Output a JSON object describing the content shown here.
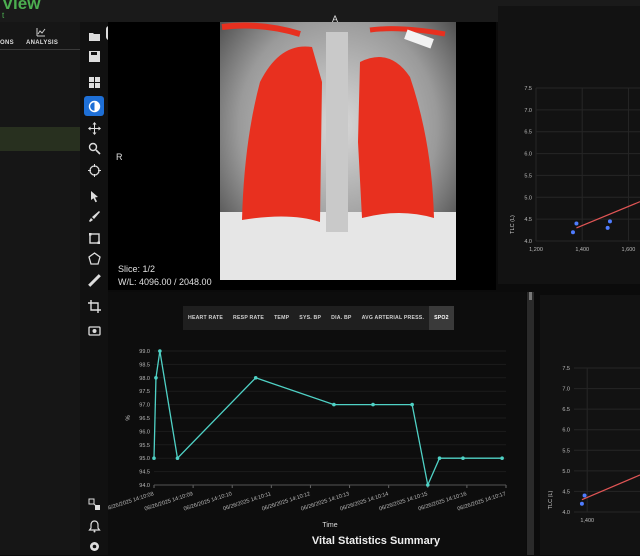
{
  "app": {
    "title": "View",
    "subtitle": "t"
  },
  "left_panel": {
    "tabs": [
      {
        "label": "ONS"
      },
      {
        "label": "ANALYSIS"
      }
    ]
  },
  "toolbar": {
    "tools": [
      "folder-icon",
      "save-icon",
      "layout-icon",
      "contrast-icon",
      "move-icon",
      "zoom-icon",
      "target-icon",
      "pointer-icon",
      "brush-icon",
      "rectangle-icon",
      "polygon-icon",
      "ruler-icon",
      "crop-icon",
      "camera-icon",
      "export-icon",
      "bell-icon",
      "gear-icon"
    ],
    "active": "contrast-icon"
  },
  "viewer": {
    "orientation_top": "A",
    "orientation_left": "R",
    "slice": "Slice: 1/2",
    "window_level": "W/L: 4096.00 / 2048.00",
    "overlay_color": "#e8301f"
  },
  "vitals": {
    "tabs": [
      "HEART RATE",
      "RESP RATE",
      "TEMP",
      "SYS. BP",
      "DIA. BP",
      "AVG ARTERIAL PRESS.",
      "SPO2"
    ],
    "active_tab": "SPO2",
    "title": "Vital Statistics Summary"
  },
  "chart_data": [
    {
      "type": "line",
      "title": "Vital Statistics Summary",
      "xlabel": "Time",
      "ylabel": "%",
      "x": [
        "06/26/2025 14:10:08",
        "06/26/2025 14:10:09",
        "06/26/2025 14:10:10",
        "06/26/2025 14:10:11",
        "06/26/2025 14:10:12",
        "06/26/2025 14:10:13",
        "06/26/2025 14:10:14",
        "06/26/2025 14:10:15",
        "06/26/2025 14:10:16",
        "06/26/2025 14:10:17"
      ],
      "yticks": [
        "99.0",
        "98.5",
        "98.0",
        "97.5",
        "97.0",
        "96.5",
        "96.0",
        "95.5",
        "95.0",
        "94.5",
        "94.0"
      ],
      "ylim": [
        94.0,
        99.0
      ],
      "series": [
        {
          "points": [
            [
              0.0,
              95.0
            ],
            [
              0.05,
              98.0
            ],
            [
              0.15,
              99.0
            ],
            [
              0.6,
              95.0
            ],
            [
              2.6,
              98.0
            ],
            [
              4.6,
              97.0
            ],
            [
              5.6,
              97.0
            ],
            [
              6.6,
              97.0
            ],
            [
              7.0,
              94.0
            ],
            [
              7.3,
              95.0
            ],
            [
              7.9,
              95.0
            ],
            [
              8.9,
              95.0
            ]
          ]
        }
      ],
      "color": "#4fd1c5"
    },
    {
      "type": "scatter",
      "ylabel": "TLC (L)",
      "x_ticks": [
        "1,200",
        "1,400",
        "1,600"
      ],
      "y_ticks": [
        "7.5",
        "7.0",
        "6.5",
        "6.0",
        "5.5",
        "5.0",
        "4.5",
        "4.0"
      ],
      "xlim": [
        1200,
        1650
      ],
      "ylim": [
        4.0,
        7.5
      ],
      "points": [
        [
          1360,
          4.2
        ],
        [
          1375,
          4.4
        ],
        [
          1510,
          4.3
        ],
        [
          1520,
          4.45
        ]
      ],
      "fit_line": [
        [
          1375,
          4.3
        ],
        [
          1650,
          4.9
        ]
      ],
      "point_color": "#4f7cff",
      "line_color": "#e05555"
    },
    {
      "type": "scatter",
      "ylabel": "TLC (L)",
      "x_ticks": [
        "1,400"
      ],
      "y_ticks": [
        "7.5",
        "7.0",
        "6.5",
        "6.0",
        "5.5",
        "5.0",
        "4.5",
        "4.0"
      ],
      "xlim": [
        1350,
        1600
      ],
      "ylim": [
        4.0,
        7.5
      ],
      "points": [
        [
          1380,
          4.2
        ],
        [
          1390,
          4.4
        ]
      ],
      "fit_line": [
        [
          1380,
          4.3
        ],
        [
          1600,
          4.9
        ]
      ],
      "point_color": "#4f7cff",
      "line_color": "#e05555"
    }
  ]
}
